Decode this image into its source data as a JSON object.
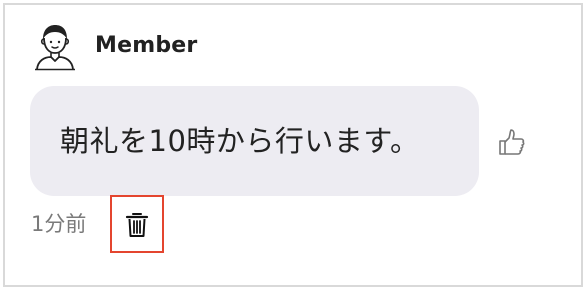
{
  "message": {
    "sender": "Member",
    "text": "朝礼を10時から行います。",
    "time": "1分前"
  },
  "icons": {
    "avatar": "person-avatar-icon",
    "like": "thumbs-up-icon",
    "delete": "trash-icon"
  },
  "colors": {
    "bubble": "#edecf2",
    "highlight": "#e4452f",
    "text": "#222222",
    "muted": "#7a7a7a"
  }
}
